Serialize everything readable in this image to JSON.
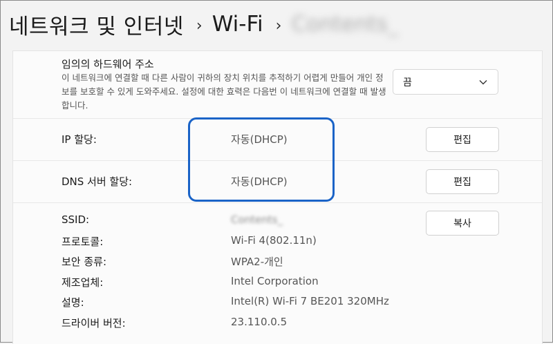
{
  "breadcrumb": {
    "item1": "네트워크 및 인터넷",
    "item2": "Wi-Fi",
    "item3": "Contents_",
    "separator": "›"
  },
  "random_mac": {
    "title": "임의의 하드웨어 주소",
    "description": "이 네트워크에 연결할 때 다른 사람이 귀하의 장치 위치를 추적하기 어렵게 만들어 개인 정보를 보호할 수 있게 도와주세요. 설정에 대한 효력은 다음번 이 네트워크에 연결할 때 발생합니다.",
    "select_value": "끔"
  },
  "ip_assignment": {
    "label": "IP 할당:",
    "value": "자동(DHCP)",
    "button": "편집"
  },
  "dns_assignment": {
    "label": "DNS 서버 할당:",
    "value": "자동(DHCP)",
    "button": "편집"
  },
  "properties": {
    "copy_button": "복사",
    "rows": [
      {
        "label": "SSID:",
        "value": "Contents_"
      },
      {
        "label": "프로토콜:",
        "value": "Wi-Fi 4(802.11n)"
      },
      {
        "label": "보안 종류:",
        "value": "WPA2-개인"
      },
      {
        "label": "제조업체:",
        "value": "Intel Corporation"
      },
      {
        "label": "설명:",
        "value": "Intel(R) Wi-Fi 7 BE201 320MHz"
      },
      {
        "label": "드라이버 버전:",
        "value": "23.110.0.5"
      }
    ]
  },
  "colors": {
    "highlight": "#1a63c7",
    "background": "#f3f3f3",
    "card": "#fbfbfb"
  }
}
